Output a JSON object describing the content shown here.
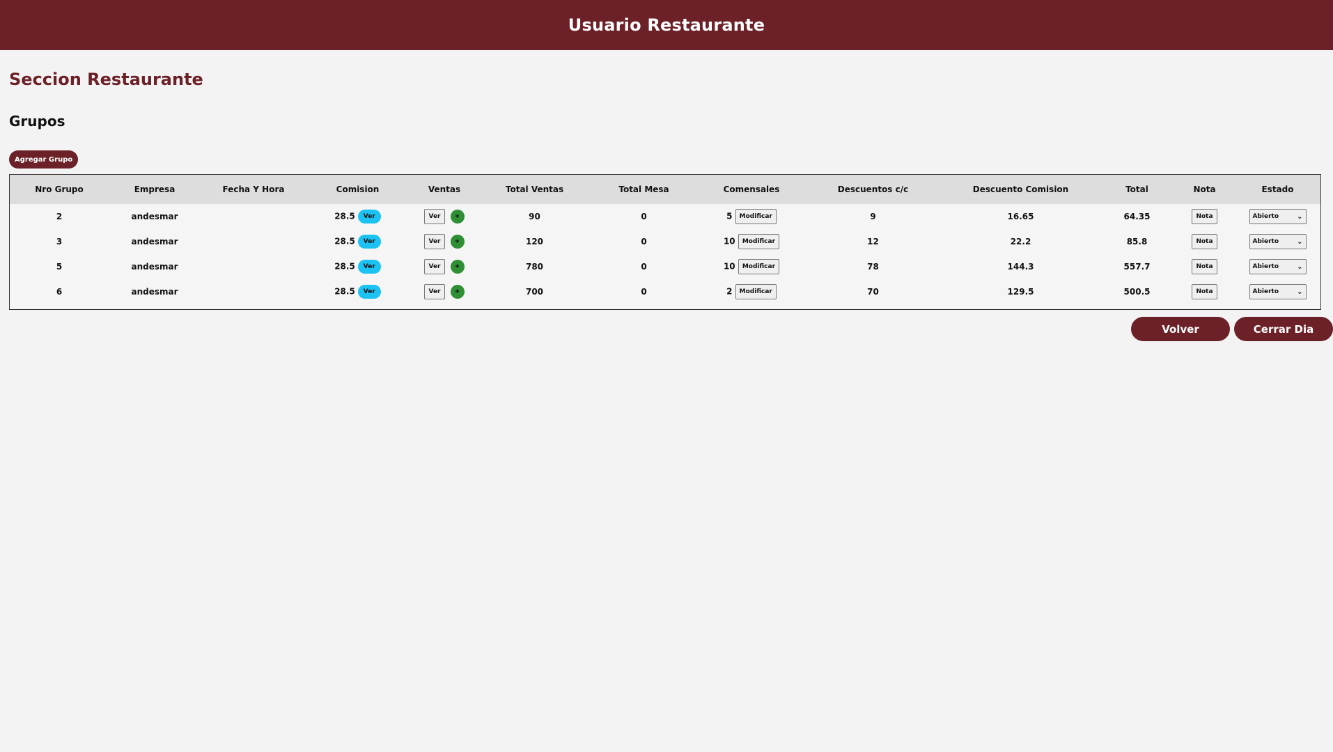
{
  "header": {
    "title": "Usuario Restaurante"
  },
  "section": {
    "title": "Seccion Restaurante",
    "subtitle": "Grupos"
  },
  "actions": {
    "add_group": "Agregar Grupo",
    "back": "Volver",
    "close_day": "Cerrar Dia"
  },
  "table": {
    "headers": [
      "Nro Grupo",
      "Empresa",
      "Fecha Y Hora",
      "Comision",
      "Ventas",
      "Total Ventas",
      "Total Mesa",
      "Comensales",
      "Descuentos c/c",
      "Descuento Comision",
      "Total",
      "Nota",
      "Estado"
    ],
    "labels": {
      "ver": "Ver",
      "plus": "+",
      "modificar": "Modificar",
      "nota": "Nota"
    },
    "rows": [
      {
        "nro": "2",
        "empresa": "andesmar",
        "fecha": "",
        "comision": "28.5",
        "total_ventas": "90",
        "total_mesa": "0",
        "comensales": "5",
        "desc_cc": "9",
        "desc_comision": "16.65",
        "total": "64.35",
        "estado": "Abierto"
      },
      {
        "nro": "3",
        "empresa": "andesmar",
        "fecha": "",
        "comision": "28.5",
        "total_ventas": "120",
        "total_mesa": "0",
        "comensales": "10",
        "desc_cc": "12",
        "desc_comision": "22.2",
        "total": "85.8",
        "estado": "Abierto"
      },
      {
        "nro": "5",
        "empresa": "andesmar",
        "fecha": "",
        "comision": "28.5",
        "total_ventas": "780",
        "total_mesa": "0",
        "comensales": "10",
        "desc_cc": "78",
        "desc_comision": "144.3",
        "total": "557.7",
        "estado": "Abierto"
      },
      {
        "nro": "6",
        "empresa": "andesmar",
        "fecha": "",
        "comision": "28.5",
        "total_ventas": "700",
        "total_mesa": "0",
        "comensales": "2",
        "desc_cc": "70",
        "desc_comision": "129.5",
        "total": "500.5",
        "estado": "Abierto"
      }
    ]
  }
}
